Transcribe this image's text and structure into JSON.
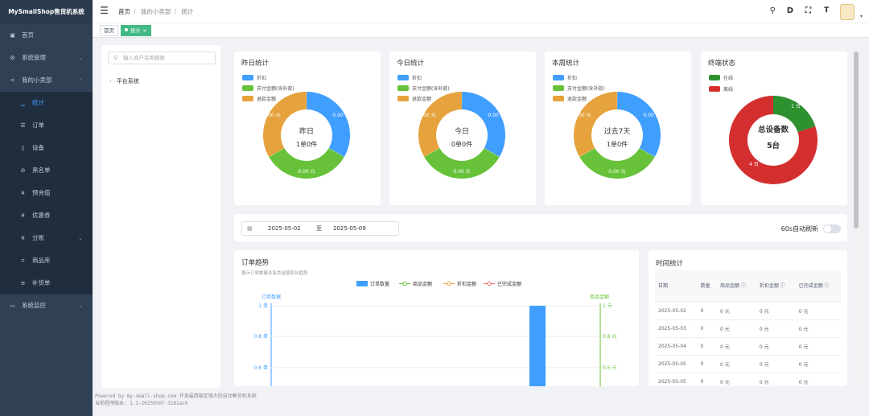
{
  "app": {
    "title": "MySmallShop售货机系统"
  },
  "sidebar": {
    "items": [
      {
        "label": "首页",
        "icon": "dashboard-icon",
        "level": "top"
      },
      {
        "label": "系统管理",
        "icon": "gear-icon",
        "level": "top",
        "chevron": true
      },
      {
        "label": "我的小卖部",
        "icon": "cart-icon",
        "level": "top",
        "chevron": true,
        "expanded": true
      },
      {
        "label": "统计",
        "icon": "chart-icon",
        "level": "sub",
        "active": true
      },
      {
        "label": "订单",
        "icon": "document-icon",
        "level": "sub"
      },
      {
        "label": "设备",
        "icon": "phone-icon",
        "level": "sub"
      },
      {
        "label": "黑名单",
        "icon": "ban-icon",
        "level": "sub"
      },
      {
        "label": "预充值",
        "icon": "yen-icon",
        "level": "sub"
      },
      {
        "label": "优惠券",
        "icon": "yen-icon",
        "level": "sub"
      },
      {
        "label": "分账",
        "icon": "yen-icon",
        "level": "sub",
        "chevron": true
      },
      {
        "label": "商品库",
        "icon": "cart-icon",
        "level": "sub"
      },
      {
        "label": "补货单",
        "icon": "list-icon",
        "level": "sub"
      },
      {
        "label": "系统监控",
        "icon": "monitor-icon",
        "level": "top",
        "chevron": true
      }
    ]
  },
  "header": {
    "breadcrumb": [
      "首页",
      "我的小卖部",
      "统计"
    ],
    "icons": [
      "search-icon",
      "d-icon",
      "fullscreen-icon",
      "font-size-icon"
    ]
  },
  "tags": [
    {
      "label": "首页"
    },
    {
      "label": "统计",
      "closable": "×"
    }
  ],
  "tree": {
    "placeholder": "输入商户名称搜索",
    "node": "平台系统"
  },
  "stat_cards": [
    {
      "title": "昨日统计",
      "center_top": "昨日",
      "center_bottom": "1单0件"
    },
    {
      "title": "今日统计",
      "center_top": "今日",
      "center_bottom": "0单0件"
    },
    {
      "title": "本周统计",
      "center_top": "过去7天",
      "center_bottom": "1单0件"
    }
  ],
  "legend_stats": [
    "折扣",
    "支付金额(含补款)",
    "退款金额"
  ],
  "colors": {
    "blue": "#409eff",
    "green": "#67c23a",
    "orange": "#e6a23c",
    "red": "#d32f2f",
    "darkgreen": "#2e9130",
    "sidebar": "#304156",
    "active": "#42b983"
  },
  "donut_labels": {
    "a": "0.00 元",
    "b": "0.00 元",
    "c": "0.00 元"
  },
  "terminal": {
    "title": "终端状态",
    "legend": [
      "在线",
      "离线"
    ],
    "center_top": "总设备数",
    "center_bottom": "5台",
    "online_label": "1 台",
    "offline_label": "4 台",
    "online": 1,
    "offline": 4
  },
  "filter": {
    "start": "2025-05-02",
    "sep": "至",
    "end": "2025-05-09",
    "auto_refresh": "60s自动刷新"
  },
  "trend": {
    "title": "订单趋势",
    "subtitle": "展示订单数量及各类金额变化趋势",
    "legend": [
      "订单数量",
      "商品金额",
      "折扣金额",
      "已完成金额"
    ],
    "y_left_name": "订单数据",
    "y_right_name": "商品金额",
    "y_left_ticks": [
      "1 单",
      "0.8 单",
      "0.6 单"
    ],
    "y_right_ticks": [
      "1 元",
      "0.8 元",
      "0.6 元"
    ]
  },
  "chart_data": {
    "type": "bar",
    "title": "订单趋势",
    "series": [
      {
        "name": "订单数量",
        "values": [
          1
        ]
      },
      {
        "name": "商品金额",
        "values": []
      },
      {
        "name": "折扣金额",
        "values": []
      },
      {
        "name": "已完成金额",
        "values": []
      }
    ],
    "ylim_left": [
      0,
      1
    ],
    "ylim_right": [
      0,
      1
    ]
  },
  "time_stats": {
    "title": "时间统计",
    "headers": [
      "日期",
      "数量",
      "商品金额",
      "折扣金额",
      "已完成金额"
    ],
    "rows": [
      [
        "2025-05-02",
        "0",
        "0 元",
        "0 元",
        "0 元"
      ],
      [
        "2025-05-03",
        "0",
        "0 元",
        "0 元",
        "0 元"
      ],
      [
        "2025-05-04",
        "0",
        "0 元",
        "0 元",
        "0 元"
      ],
      [
        "2025-05-05",
        "0",
        "0 元",
        "0 元",
        "0 元"
      ],
      [
        "2025-05-05",
        "0",
        "0 元",
        "0 元",
        "0 元"
      ]
    ]
  },
  "footer": {
    "line1": "Powered by my-small-shop.com 开发最用稳定强大的自动售货机系统",
    "line2": "当前程序版本: 1.1-20250507-3181ac0"
  }
}
